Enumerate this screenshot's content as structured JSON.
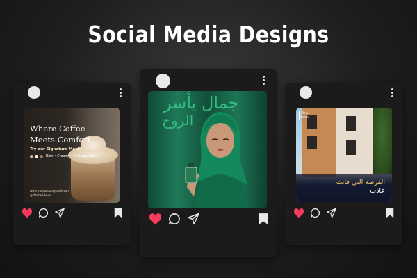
{
  "page": {
    "title": "Social Media Designs"
  },
  "posts": [
    {
      "id": "coffee",
      "headline_line1": "Where Coffee",
      "headline_line2": "Meets Comfort",
      "subline": "Try our Signature Mocha Splash",
      "tags": "Rich • Creamy • Unforgettable",
      "url": "www.mochaluxuryscafe.com",
      "handle": "@MochaSiLuxe",
      "dot_colors": [
        "#d7b58a",
        "#f3efe9",
        "#a8764a"
      ]
    },
    {
      "id": "perfume",
      "arabic_line1": "جمال يأسر",
      "arabic_line2": "الروح"
    },
    {
      "id": "real-estate",
      "logo_text": "Real Estate",
      "arabic_line1": "الفرصة التي فاتت",
      "arabic_line2": "عادت"
    }
  ],
  "colors": {
    "heart": "#f23c5b",
    "icon": "#e8e8e8",
    "card": "#1b1b1b"
  },
  "icons": [
    "heart-icon",
    "comment-icon",
    "share-icon",
    "bookmark-icon",
    "more-options-icon",
    "avatar"
  ]
}
